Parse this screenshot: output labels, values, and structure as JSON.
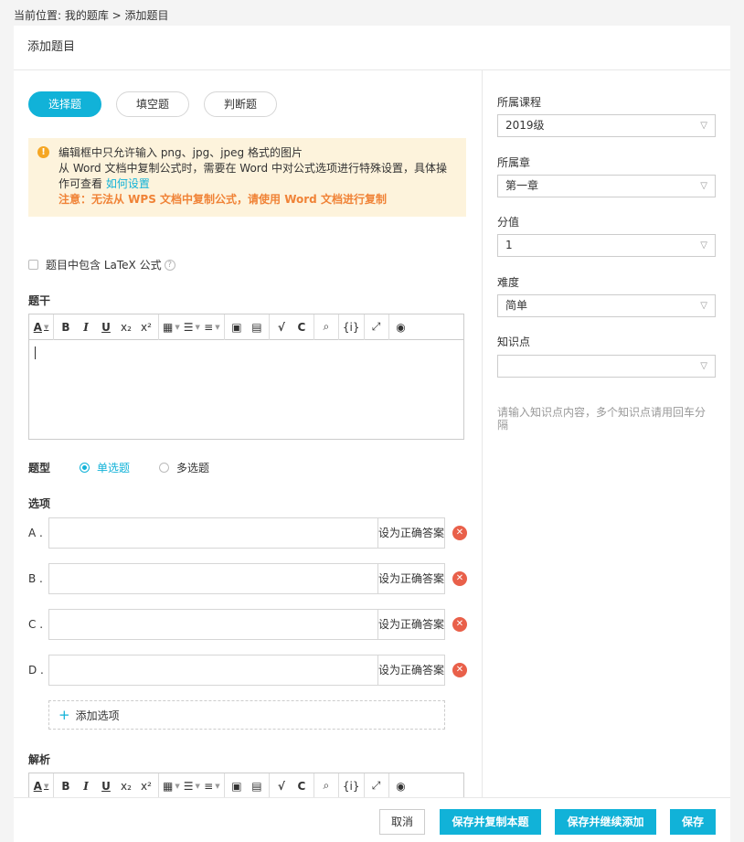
{
  "breadcrumb": "当前位置: 我的题库 > 添加题目",
  "page_title": "添加题目",
  "type_tabs": [
    {
      "label": "选择题",
      "active": true
    },
    {
      "label": "填空题",
      "active": false
    },
    {
      "label": "判断题",
      "active": false
    }
  ],
  "notice": {
    "line1": "编辑框中只允许输入 png、jpg、jpeg 格式的图片",
    "line2": "从 Word 文档中复制公式时，需要在 Word 中对公式选项进行特殊设置，具体操作可查看",
    "link": "如何设置",
    "warning": "注意：无法从 WPS 文档中复制公式，请使用 Word 文档进行复制"
  },
  "latex_label": "题目中包含 LaTeX 公式",
  "stem_label": "题干",
  "qtype": {
    "label": "题型",
    "single": "单选题",
    "multi": "多选题"
  },
  "options_label": "选项",
  "options": [
    {
      "letter": "A .",
      "value": "",
      "correct_label": "设为正确答案"
    },
    {
      "letter": "B .",
      "value": "",
      "correct_label": "设为正确答案"
    },
    {
      "letter": "C .",
      "value": "",
      "correct_label": "设为正确答案"
    },
    {
      "letter": "D .",
      "value": "",
      "correct_label": "设为正确答案"
    }
  ],
  "add_option": "添加选项",
  "analysis_label": "解析",
  "toolbar": {
    "font_color": "A",
    "bold": "B",
    "italic": "I",
    "underline": "U",
    "subscript": "x₂",
    "superscript": "x²",
    "code": "{i}"
  },
  "right": {
    "course_label": "所属课程",
    "course_value": "2019级",
    "chapter_label": "所属章",
    "chapter_value": "第一章",
    "score_label": "分值",
    "score_value": "1",
    "difficulty_label": "难度",
    "difficulty_value": "简单",
    "knowledge_label": "知识点",
    "knowledge_value": "",
    "knowledge_hint": "请输入知识点内容，多个知识点请用回车分隔"
  },
  "footer": {
    "cancel": "取消",
    "save_copy": "保存并复制本题",
    "save_continue": "保存并继续添加",
    "save": "保存"
  },
  "colors": {
    "accent": "#11b2d8",
    "warning": "#f08337",
    "notice_bg": "#fdf3dc",
    "delete": "#e9604a"
  }
}
